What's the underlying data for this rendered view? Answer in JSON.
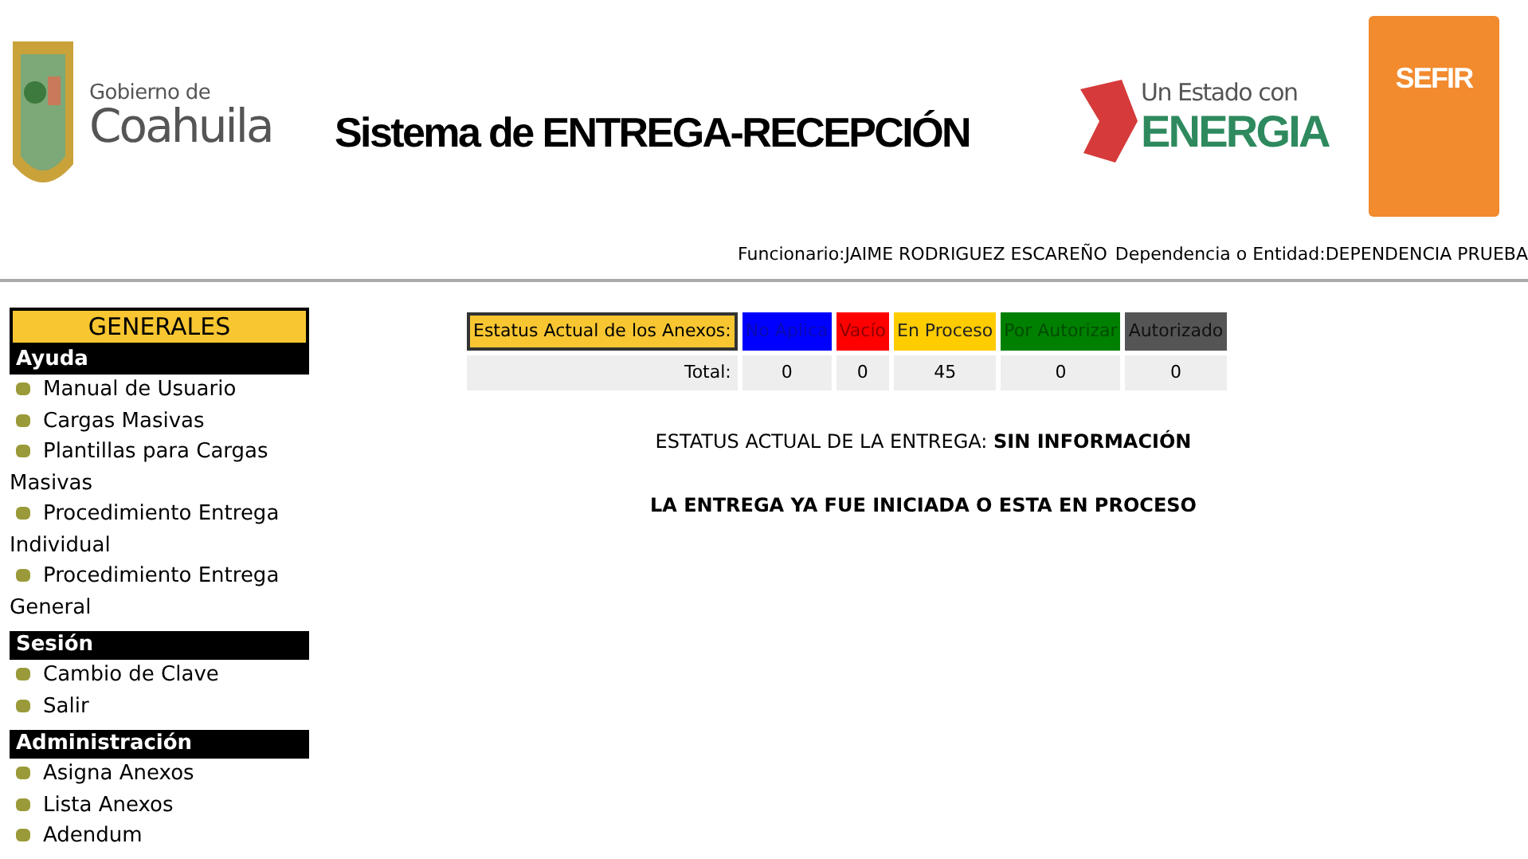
{
  "header": {
    "logo_left": {
      "line1": "Gobierno de",
      "line2": "Coahuila"
    },
    "title": "Sistema de ENTREGA-RECEPCIÓN",
    "logo_energia": {
      "line1": "Un Estado con",
      "line2": "ENERGIA"
    },
    "logo_sefir": {
      "text": "SEFIR"
    }
  },
  "user_bar": {
    "funcionario_label": "Funcionario:",
    "funcionario": "JAIME RODRIGUEZ ESCAREÑO",
    "dependencia_label": "Dependencia o Entidad:",
    "dependencia": "DEPENDENCIA PRUEBA"
  },
  "sidebar": {
    "title": "GENERALES",
    "sections": [
      {
        "heading": "Ayuda",
        "items": [
          "Manual de Usuario",
          "Cargas Masivas",
          "Plantillas para Cargas Masivas",
          "Procedimiento Entrega Individual",
          "Procedimiento Entrega General"
        ]
      },
      {
        "heading": "Sesión",
        "items": [
          "Cambio de Clave",
          "Salir"
        ]
      },
      {
        "heading": "Administración",
        "items": [
          "Asigna Anexos",
          "Lista Anexos",
          "Adendum"
        ]
      }
    ]
  },
  "status_table": {
    "header_label": "Estatus Actual de los Anexos:",
    "total_label": "Total:",
    "columns": [
      {
        "label": "No Aplica",
        "color": "#0000ff",
        "total": "0"
      },
      {
        "label": "Vacío",
        "color": "#ff0000",
        "total": "0"
      },
      {
        "label": "En Proceso",
        "color": "#ffcc00",
        "total": "45"
      },
      {
        "label": "Por Autorizar",
        "color": "#008000",
        "total": "0"
      },
      {
        "label": "Autorizado",
        "color": "#555555",
        "total": "0"
      }
    ]
  },
  "entrega_status": {
    "label": "ESTATUS ACTUAL DE LA ENTREGA:",
    "value": "SIN INFORMACIÓN"
  },
  "message": "LA ENTREGA YA FUE INICIADA O ESTA EN PROCESO"
}
